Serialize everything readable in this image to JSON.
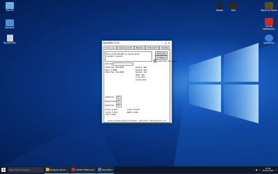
{
  "desktop": {
    "left_icons": [
      {
        "label": "This PC",
        "icon": "this-pc-icon"
      },
      {
        "label": "Network",
        "icon": "network-icon"
      },
      {
        "label": "Recycle Bin",
        "icon": "recycle-bin-icon"
      }
    ],
    "right_icons": [
      {
        "label": "Steam",
        "icon": "steam-icon"
      },
      {
        "label": "Kick",
        "icon": "kick-icon"
      },
      {
        "label": "World of Tanks",
        "icon": "world-of-tanks-icon"
      },
      {
        "label": "CPUID HWMonitor",
        "icon": "hwmonitor-icon"
      },
      {
        "label": "SpeedFan",
        "icon": "speedfan-icon"
      }
    ]
  },
  "window": {
    "title": "SpeedFan 4.52",
    "tabs": [
      "Readings",
      "Clock",
      "Info",
      "Exotics",
      "S.M.A.R.T.",
      "Charts"
    ],
    "log_lines": [
      "Found ITE IT8728F on ISA at $A30",
      "Loaded 7 events"
    ],
    "buttons": {
      "minimize": "Minimize",
      "configure": "Configure"
    },
    "auto_speed_label": "Automatic fan speed",
    "cpu_usage_label": "CPU Usage",
    "fans": [
      {
        "label": "CPU0 Fan:",
        "value": "965 RPM"
      },
      {
        "label": "Fan2:",
        "value": "0 RPM"
      },
      {
        "label": "CPU1 Fan:",
        "value": "781 RPM"
      }
    ],
    "temps": [
      {
        "label": "Temp1:",
        "value": "36C"
      },
      {
        "label": "Temp2:",
        "value": "35C"
      },
      {
        "label": "Temp3:",
        "value": "34C"
      },
      {
        "label": "HD0:",
        "value": "33C"
      },
      {
        "label": "Core:",
        "value": "41C"
      },
      {
        "label": "Core1:",
        "value": "41C"
      }
    ],
    "speeds": [
      {
        "label": "CPU0 Fan:",
        "value": "70"
      },
      {
        "label": "System Fan:",
        "value": "70"
      },
      {
        "label": "CPU1 Fan:",
        "value": "70"
      }
    ],
    "voltages": [
      {
        "label": "Vcore:",
        "value": "1.44V"
      },
      {
        "label": "+3.3V:",
        "value": "3.34V"
      },
      {
        "label": "+5V:",
        "value": "4.99V"
      },
      {
        "label": "+12V:",
        "value": "12.10V"
      },
      {
        "label": "VBAT:",
        "value": "3.18V"
      }
    ],
    "status_text": "Coded by Alfredo Milani Comparetti - 2000-2015 - alfredo@almico.com"
  },
  "taskbar": {
    "search_placeholder": "Type here to search",
    "apps": [
      {
        "label": "Notepad about ...",
        "icon": "notepad-icon",
        "color": "#e7a43b"
      },
      {
        "label": "CPUID HWMonitor",
        "icon": "hwmonitor-icon",
        "color": "#c0302b"
      },
      {
        "label": "SpeedFan",
        "icon": "speedfan-icon",
        "color": "#3b7dd8"
      }
    ],
    "time": "10:38",
    "date": "05/01/2018"
  },
  "colors": {
    "accent": "#3b7dd8",
    "taskbar": "#101826",
    "window_border": "#3a6fb0"
  }
}
